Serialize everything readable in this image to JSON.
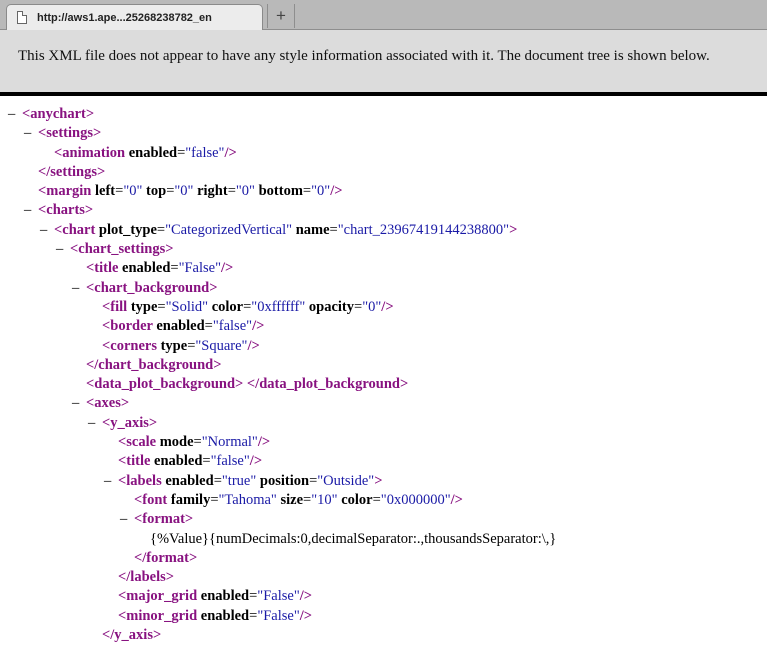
{
  "tab": {
    "title": "http://aws1.ape...25268238782_en",
    "new_tab_label": "+"
  },
  "info_message": "This XML file does not appear to have any style information associated with it. The document tree is shown below.",
  "lines": [
    {
      "indent": 0,
      "fold": "–",
      "parts": [
        [
          "t",
          "<anychart>"
        ]
      ]
    },
    {
      "indent": 1,
      "fold": "–",
      "parts": [
        [
          "t",
          "<settings>"
        ]
      ]
    },
    {
      "indent": 2,
      "fold": "",
      "parts": [
        [
          "t",
          "<animation "
        ],
        [
          "a",
          "enabled"
        ],
        [
          "s",
          "="
        ],
        [
          "v",
          "\"false\""
        ],
        [
          "t",
          "/>"
        ]
      ]
    },
    {
      "indent": 1,
      "fold": "",
      "parts": [
        [
          "t",
          "</settings>"
        ]
      ]
    },
    {
      "indent": 1,
      "fold": "",
      "parts": [
        [
          "t",
          "<margin "
        ],
        [
          "a",
          "left"
        ],
        [
          "s",
          "="
        ],
        [
          "v",
          "\"0\""
        ],
        [
          "a",
          " top"
        ],
        [
          "s",
          "="
        ],
        [
          "v",
          "\"0\""
        ],
        [
          "a",
          " right"
        ],
        [
          "s",
          "="
        ],
        [
          "v",
          "\"0\""
        ],
        [
          "a",
          " bottom"
        ],
        [
          "s",
          "="
        ],
        [
          "v",
          "\"0\""
        ],
        [
          "t",
          "/>"
        ]
      ]
    },
    {
      "indent": 1,
      "fold": "–",
      "parts": [
        [
          "t",
          "<charts>"
        ]
      ]
    },
    {
      "indent": 2,
      "fold": "–",
      "parts": [
        [
          "t",
          "<chart "
        ],
        [
          "a",
          "plot_type"
        ],
        [
          "s",
          "="
        ],
        [
          "v",
          "\"CategorizedVertical\""
        ],
        [
          "a",
          " name"
        ],
        [
          "s",
          "="
        ],
        [
          "v",
          "\"chart_23967419144238800\""
        ],
        [
          "t",
          ">"
        ]
      ]
    },
    {
      "indent": 3,
      "fold": "–",
      "parts": [
        [
          "t",
          "<chart_settings>"
        ]
      ]
    },
    {
      "indent": 4,
      "fold": "",
      "parts": [
        [
          "t",
          "<title "
        ],
        [
          "a",
          "enabled"
        ],
        [
          "s",
          "="
        ],
        [
          "v",
          "\"False\""
        ],
        [
          "t",
          "/>"
        ]
      ]
    },
    {
      "indent": 4,
      "fold": "–",
      "parts": [
        [
          "t",
          "<chart_background>"
        ]
      ]
    },
    {
      "indent": 5,
      "fold": "",
      "parts": [
        [
          "t",
          "<fill "
        ],
        [
          "a",
          "type"
        ],
        [
          "s",
          "="
        ],
        [
          "v",
          "\"Solid\""
        ],
        [
          "a",
          " color"
        ],
        [
          "s",
          "="
        ],
        [
          "v",
          "\"0xffffff\""
        ],
        [
          "a",
          " opacity"
        ],
        [
          "s",
          "="
        ],
        [
          "v",
          "\"0\""
        ],
        [
          "t",
          "/>"
        ]
      ]
    },
    {
      "indent": 5,
      "fold": "",
      "parts": [
        [
          "t",
          "<border "
        ],
        [
          "a",
          "enabled"
        ],
        [
          "s",
          "="
        ],
        [
          "v",
          "\"false\""
        ],
        [
          "t",
          "/>"
        ]
      ]
    },
    {
      "indent": 5,
      "fold": "",
      "parts": [
        [
          "t",
          "<corners "
        ],
        [
          "a",
          "type"
        ],
        [
          "s",
          "="
        ],
        [
          "v",
          "\"Square\""
        ],
        [
          "t",
          "/>"
        ]
      ]
    },
    {
      "indent": 4,
      "fold": "",
      "parts": [
        [
          "t",
          "</chart_background>"
        ]
      ]
    },
    {
      "indent": 4,
      "fold": "",
      "parts": [
        [
          "t",
          "<data_plot_background>"
        ],
        [
          "s",
          " "
        ],
        [
          "t",
          "</data_plot_background>"
        ]
      ]
    },
    {
      "indent": 4,
      "fold": "–",
      "parts": [
        [
          "t",
          "<axes>"
        ]
      ]
    },
    {
      "indent": 5,
      "fold": "–",
      "parts": [
        [
          "t",
          "<y_axis>"
        ]
      ]
    },
    {
      "indent": 6,
      "fold": "",
      "parts": [
        [
          "t",
          "<scale "
        ],
        [
          "a",
          "mode"
        ],
        [
          "s",
          "="
        ],
        [
          "v",
          "\"Normal\""
        ],
        [
          "t",
          "/>"
        ]
      ]
    },
    {
      "indent": 6,
      "fold": "",
      "parts": [
        [
          "t",
          "<title "
        ],
        [
          "a",
          "enabled"
        ],
        [
          "s",
          "="
        ],
        [
          "v",
          "\"false\""
        ],
        [
          "t",
          "/>"
        ]
      ]
    },
    {
      "indent": 6,
      "fold": "–",
      "parts": [
        [
          "t",
          "<labels "
        ],
        [
          "a",
          "enabled"
        ],
        [
          "s",
          "="
        ],
        [
          "v",
          "\"true\""
        ],
        [
          "a",
          " position"
        ],
        [
          "s",
          "="
        ],
        [
          "v",
          "\"Outside\""
        ],
        [
          "t",
          ">"
        ]
      ]
    },
    {
      "indent": 7,
      "fold": "",
      "parts": [
        [
          "t",
          "<font "
        ],
        [
          "a",
          "family"
        ],
        [
          "s",
          "="
        ],
        [
          "v",
          "\"Tahoma\""
        ],
        [
          "a",
          " size"
        ],
        [
          "s",
          "="
        ],
        [
          "v",
          "\"10\""
        ],
        [
          "a",
          " color"
        ],
        [
          "s",
          "="
        ],
        [
          "v",
          "\"0x000000\""
        ],
        [
          "t",
          "/>"
        ]
      ]
    },
    {
      "indent": 7,
      "fold": "–",
      "parts": [
        [
          "t",
          "<format>"
        ]
      ]
    },
    {
      "indent": 8,
      "fold": "",
      "parts": [
        [
          "s",
          "{%Value}{numDecimals:0,decimalSeparator:.,thousandsSeparator:\\,}"
        ]
      ]
    },
    {
      "indent": 7,
      "fold": "",
      "parts": [
        [
          "t",
          "</format>"
        ]
      ]
    },
    {
      "indent": 6,
      "fold": "",
      "parts": [
        [
          "t",
          "</labels>"
        ]
      ]
    },
    {
      "indent": 6,
      "fold": "",
      "parts": [
        [
          "t",
          "<major_grid "
        ],
        [
          "a",
          "enabled"
        ],
        [
          "s",
          "="
        ],
        [
          "v",
          "\"False\""
        ],
        [
          "t",
          "/>"
        ]
      ]
    },
    {
      "indent": 6,
      "fold": "",
      "parts": [
        [
          "t",
          "<minor_grid "
        ],
        [
          "a",
          "enabled"
        ],
        [
          "s",
          "="
        ],
        [
          "v",
          "\"False\""
        ],
        [
          "t",
          "/>"
        ]
      ]
    },
    {
      "indent": 5,
      "fold": "",
      "parts": [
        [
          "t",
          "</y_axis>"
        ]
      ]
    }
  ],
  "colors": {
    "tag": "#881280",
    "attribute": "#000000",
    "value": "#1a1aa6",
    "info_bar_bg": "#dcdcdc"
  }
}
